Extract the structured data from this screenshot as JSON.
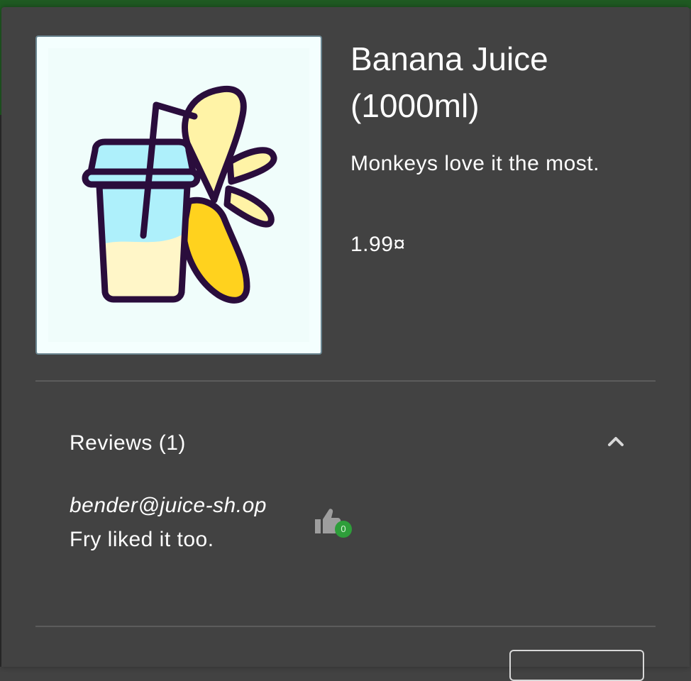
{
  "product": {
    "title": "Banana Juice (1000ml)",
    "description": "Monkeys love it the most.",
    "price": "1.99¤",
    "image_icon": "banana-juice-cup-icon"
  },
  "reviews": {
    "header": "Reviews (1)",
    "expanded": true,
    "items": [
      {
        "author": "bender@juice-sh.op",
        "text": "Fry liked it too.",
        "likes": "0"
      }
    ]
  },
  "colors": {
    "dialog_bg": "#424242",
    "toolbar_green": "#1f5a22",
    "badge_green": "#2e9e3a",
    "image_bg": "#f4fffe"
  }
}
